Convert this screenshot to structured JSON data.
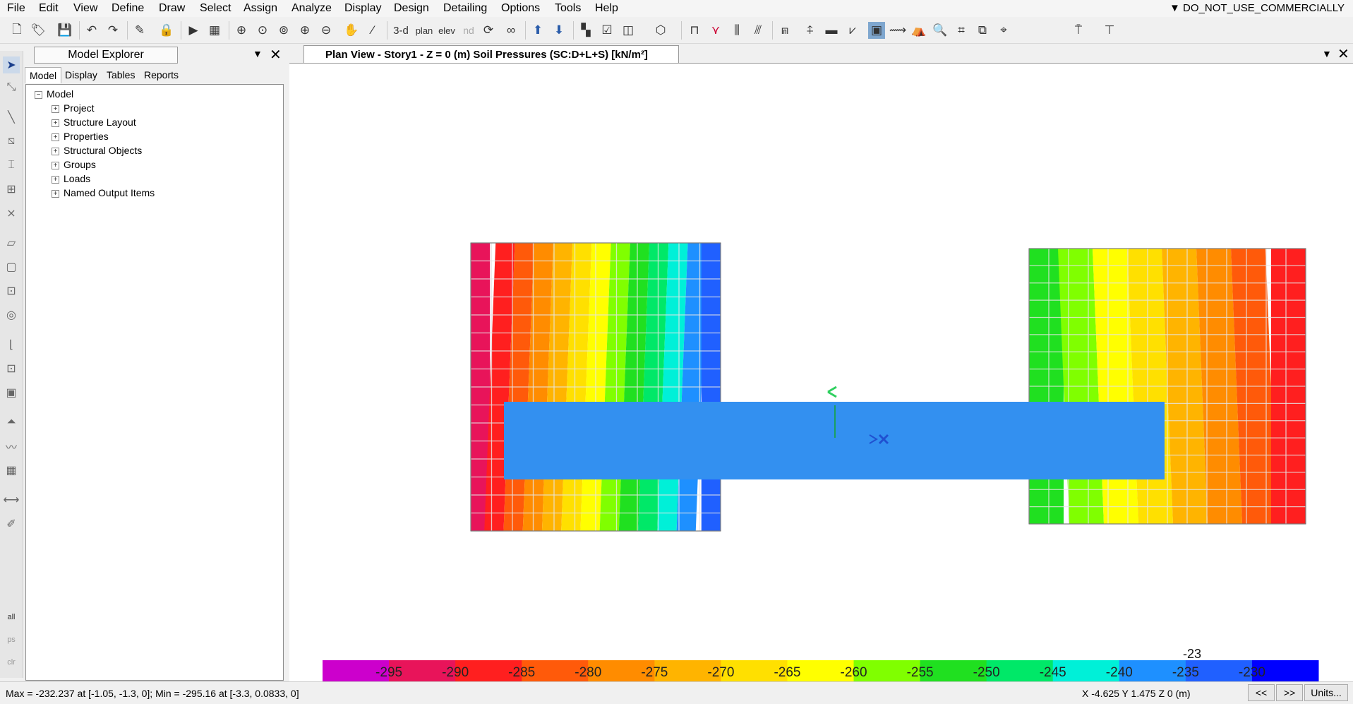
{
  "menubar": {
    "items": [
      "File",
      "Edit",
      "View",
      "Define",
      "Draw",
      "Select",
      "Assign",
      "Analyze",
      "Display",
      "Design",
      "Detailing",
      "Options",
      "Tools",
      "Help"
    ],
    "license": "▼ DO_NOT_USE_COMMERCIALLY"
  },
  "toolbar": {
    "buttons": [
      "new-model-icon",
      "open-icon",
      "save-icon",
      "undo-icon",
      "redo-icon",
      "pencil-icon",
      "lock-icon",
      "run-icon",
      "analysis-icon",
      "zoom-window-icon",
      "zoom-restore-icon",
      "zoom-previous-icon",
      "zoom-in-icon",
      "zoom-out-icon",
      "pan-icon",
      "wand-icon"
    ],
    "view3d_label": "3-d",
    "plan_label": "plan",
    "elev_label": "elev",
    "nd_label": "nd"
  },
  "explorer": {
    "title": "Model Explorer",
    "tabs": [
      "Model",
      "Display",
      "Tables",
      "Reports"
    ],
    "root": "Model",
    "nodes": [
      "Project",
      "Structure Layout",
      "Properties",
      "Structural Objects",
      "Groups",
      "Loads",
      "Named Output Items"
    ]
  },
  "view": {
    "tab_title": "Plan View - Story1 - Z = 0 (m)     Soil Pressures    (SC:D+L+S)  [kN/m²]"
  },
  "legend": {
    "labels": [
      "-295",
      "-290",
      "-285",
      "-280",
      "-275",
      "-270",
      "-265",
      "-260",
      "-255",
      "-250",
      "-245",
      "-240",
      "-235",
      "-230"
    ],
    "colors": [
      "#cc00cc",
      "#e8145a",
      "#ff1f1f",
      "#ff5a0a",
      "#ff8c00",
      "#ffb400",
      "#ffe000",
      "#ffff00",
      "#80ff00",
      "#20e020",
      "#00e868",
      "#00f0d8",
      "#1e90ff",
      "#2060ff",
      "#0000ff"
    ]
  },
  "plot": {
    "left_footing_bands": [
      "#e8145a",
      "#ff1f1f",
      "#ff5a0a",
      "#ff8c00",
      "#ffb400",
      "#ffe000",
      "#ffff00",
      "#80ff00",
      "#20e020",
      "#00e868",
      "#00f0d8",
      "#1e90ff",
      "#2060ff"
    ],
    "right_footing_bands": [
      "#20e020",
      "#80ff00",
      "#ffff00",
      "#ffe000",
      "#ffb400",
      "#ff8c00",
      "#ff5a0a",
      "#ff1f1f"
    ],
    "beam_color": "#3390f0"
  },
  "status": {
    "left": "Max = -232.237 at [-1.05, -1.3, 0];  Min = -295.16 at [-3.3, 0.0833, 0]",
    "coords": "X -4.625  Y 1.475  Z 0 (m)",
    "prev": "<<",
    "next": ">>",
    "units": "Units..."
  }
}
